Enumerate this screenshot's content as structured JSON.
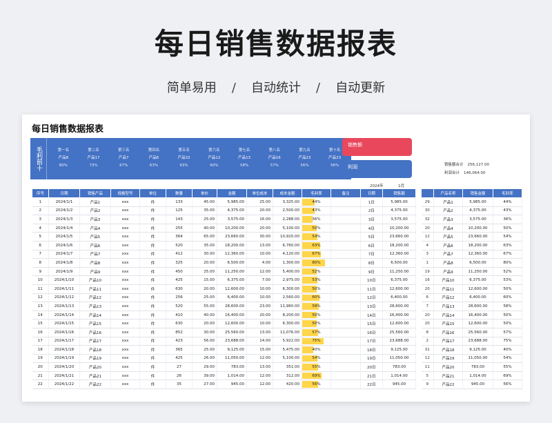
{
  "hero": {
    "title": "每日销售数据报表",
    "subtitle": [
      "简单易用",
      "自动统计",
      "自动更新"
    ],
    "sep": "/"
  },
  "sheet": {
    "title": "每日销售数据报表",
    "rank_head": "毛利前十",
    "ranks": [
      {
        "label": "第一名",
        "product": "产品8",
        "rate": "80%"
      },
      {
        "label": "第二名",
        "product": "产品17",
        "rate": "73%"
      },
      {
        "label": "第三名",
        "product": "产品7",
        "rate": "67%"
      },
      {
        "label": "第四名",
        "product": "产品6",
        "rate": "63%"
      },
      {
        "label": "第五名",
        "product": "产品32",
        "rate": "63%"
      },
      {
        "label": "第六名",
        "product": "产品12",
        "rate": "60%"
      },
      {
        "label": "第七名",
        "product": "产品13",
        "rate": "58%"
      },
      {
        "label": "第八名",
        "product": "产品16",
        "rate": "57%"
      },
      {
        "label": "第九名",
        "product": "产品23",
        "rate": "56%"
      },
      {
        "label": "第十名",
        "product": "产品23",
        "rate": "56%"
      }
    ],
    "sales_label": "销售额",
    "profit_label": "利润",
    "total_sales_label": "销售额合计",
    "total_sales": "256,127.00",
    "total_profit_label": "利润合计",
    "total_profit": "146,064.00",
    "year": "2024年",
    "month": "1月",
    "headers": [
      "序号",
      "日期",
      "销售产品",
      "规格型号",
      "单位",
      "数量",
      "单价",
      "金额",
      "单位成本",
      "成本金额",
      "毛利率",
      "备注"
    ],
    "daily_headers": [
      "日期",
      "销售额"
    ],
    "top_headers": [
      "产品名称",
      "销售金额",
      "毛利率"
    ],
    "rows": [
      [
        "1",
        "2024/1/1",
        "产品1",
        "xxx",
        "件",
        "133",
        "45.00",
        "5,985.00",
        "25.00",
        "3,325.00",
        "44%"
      ],
      [
        "2",
        "2024/1/2",
        "产品2",
        "xxx",
        "件",
        "125",
        "35.00",
        "4,375.00",
        "20.00",
        "2,500.00",
        "43%"
      ],
      [
        "3",
        "2024/1/3",
        "产品3",
        "xxx",
        "件",
        "143",
        "25.00",
        "3,575.00",
        "16.00",
        "2,288.00",
        "36%"
      ],
      [
        "4",
        "2024/1/4",
        "产品4",
        "xxx",
        "件",
        "255",
        "40.00",
        "10,200.00",
        "20.00",
        "5,100.00",
        "50%"
      ],
      [
        "5",
        "2024/1/5",
        "产品5",
        "xxx",
        "件",
        "364",
        "65.00",
        "23,660.00",
        "30.00",
        "10,920.00",
        "54%"
      ],
      [
        "6",
        "2024/1/6",
        "产品6",
        "xxx",
        "件",
        "520",
        "35.00",
        "18,200.00",
        "13.00",
        "6,760.00",
        "63%"
      ],
      [
        "7",
        "2024/1/7",
        "产品7",
        "xxx",
        "件",
        "412",
        "30.00",
        "12,360.00",
        "10.00",
        "4,120.00",
        "67%"
      ],
      [
        "8",
        "2024/1/8",
        "产品8",
        "xxx",
        "件",
        "325",
        "20.00",
        "6,500.00",
        "4.00",
        "1,300.00",
        "80%"
      ],
      [
        "9",
        "2024/1/9",
        "产品9",
        "xxx",
        "件",
        "450",
        "25.00",
        "11,250.00",
        "12.00",
        "5,400.00",
        "52%"
      ],
      [
        "10",
        "2024/1/10",
        "产品10",
        "xxx",
        "件",
        "425",
        "15.00",
        "6,375.00",
        "7.00",
        "2,975.00",
        "53%"
      ],
      [
        "11",
        "2024/1/11",
        "产品11",
        "xxx",
        "件",
        "630",
        "20.00",
        "12,600.00",
        "10.00",
        "6,300.00",
        "50%"
      ],
      [
        "12",
        "2024/1/12",
        "产品12",
        "xxx",
        "件",
        "256",
        "25.00",
        "6,400.00",
        "10.00",
        "2,560.00",
        "60%"
      ],
      [
        "13",
        "2024/1/13",
        "产品13",
        "xxx",
        "件",
        "520",
        "55.00",
        "28,600.00",
        "23.00",
        "11,960.00",
        "58%"
      ],
      [
        "14",
        "2024/1/14",
        "产品14",
        "xxx",
        "件",
        "410",
        "40.00",
        "16,400.00",
        "20.00",
        "8,200.00",
        "50%"
      ],
      [
        "15",
        "2024/1/15",
        "产品15",
        "xxx",
        "件",
        "630",
        "20.00",
        "12,600.00",
        "10.00",
        "6,300.00",
        "50%"
      ],
      [
        "16",
        "2024/1/16",
        "产品16",
        "xxx",
        "件",
        "852",
        "30.00",
        "25,560.00",
        "13.00",
        "11,076.00",
        "57%"
      ],
      [
        "17",
        "2024/1/17",
        "产品17",
        "xxx",
        "件",
        "423",
        "56.00",
        "23,688.00",
        "14.00",
        "5,922.00",
        "75%"
      ],
      [
        "18",
        "2024/1/18",
        "产品18",
        "xxx",
        "件",
        "365",
        "25.00",
        "9,125.00",
        "15.00",
        "5,475.00",
        "40%"
      ],
      [
        "19",
        "2024/1/19",
        "产品19",
        "xxx",
        "件",
        "425",
        "26.00",
        "11,050.00",
        "12.00",
        "5,100.00",
        "54%"
      ],
      [
        "20",
        "2024/1/20",
        "产品20",
        "xxx",
        "件",
        "27",
        "29.00",
        "783.00",
        "13.00",
        "351.00",
        "55%"
      ],
      [
        "21",
        "2024/1/21",
        "产品21",
        "xxx",
        "件",
        "26",
        "39.00",
        "1,014.00",
        "12.00",
        "312.00",
        "69%"
      ],
      [
        "22",
        "2024/1/22",
        "产品22",
        "xxx",
        "件",
        "35",
        "27.00",
        "945.00",
        "12.00",
        "420.00",
        "56%"
      ]
    ],
    "daily": [
      [
        "1日",
        "5,985.00"
      ],
      [
        "2日",
        "4,375.00"
      ],
      [
        "3日",
        "3,575.00"
      ],
      [
        "4日",
        "10,200.00"
      ],
      [
        "5日",
        "23,660.00"
      ],
      [
        "6日",
        "18,200.00"
      ],
      [
        "7日",
        "12,360.00"
      ],
      [
        "8日",
        "6,500.00"
      ],
      [
        "9日",
        "11,250.00"
      ],
      [
        "10日",
        "6,375.00"
      ],
      [
        "11日",
        "12,600.00"
      ],
      [
        "12日",
        "6,400.00"
      ],
      [
        "13日",
        "28,600.00"
      ],
      [
        "14日",
        "16,400.00"
      ],
      [
        "15日",
        "12,600.00"
      ],
      [
        "16日",
        "25,560.00"
      ],
      [
        "17日",
        "23,688.00"
      ],
      [
        "18日",
        "9,125.00"
      ],
      [
        "19日",
        "11,050.00"
      ],
      [
        "20日",
        "783.00"
      ],
      [
        "21日",
        "1,014.00"
      ],
      [
        "22日",
        "945.00"
      ]
    ],
    "top": [
      [
        "29",
        "产品1",
        "5,985.00",
        "44%"
      ],
      [
        "30",
        "产品2",
        "4,375.00",
        "43%"
      ],
      [
        "32",
        "产品3",
        "3,575.00",
        "36%"
      ],
      [
        "20",
        "产品4",
        "10,200.00",
        "50%"
      ],
      [
        "12",
        "产品5",
        "23,660.00",
        "54%"
      ],
      [
        "4",
        "产品6",
        "18,200.00",
        "63%"
      ],
      [
        "3",
        "产品7",
        "12,360.00",
        "67%"
      ],
      [
        "1",
        "产品8",
        "6,500.00",
        "80%"
      ],
      [
        "19",
        "产品9",
        "11,250.00",
        "52%"
      ],
      [
        "16",
        "产品10",
        "6,375.00",
        "53%"
      ],
      [
        "20",
        "产品11",
        "12,600.00",
        "50%"
      ],
      [
        "6",
        "产品12",
        "6,400.00",
        "60%"
      ],
      [
        "7",
        "产品13",
        "28,600.00",
        "58%"
      ],
      [
        "20",
        "产品14",
        "16,400.00",
        "50%"
      ],
      [
        "20",
        "产品15",
        "12,600.00",
        "50%"
      ],
      [
        "8",
        "产品16",
        "25,560.00",
        "57%"
      ],
      [
        "2",
        "产品17",
        "23,688.00",
        "75%"
      ],
      [
        "31",
        "产品18",
        "9,125.00",
        "40%"
      ],
      [
        "12",
        "产品19",
        "11,050.00",
        "54%"
      ],
      [
        "11",
        "产品20",
        "783.00",
        "55%"
      ],
      [
        "5",
        "产品21",
        "1,014.00",
        "69%"
      ],
      [
        "9",
        "产品22",
        "945.00",
        "56%"
      ]
    ],
    "colors": {
      "header": "#4472c4",
      "sales_pill": "#e8475c",
      "bar": "#ffd54a"
    }
  }
}
